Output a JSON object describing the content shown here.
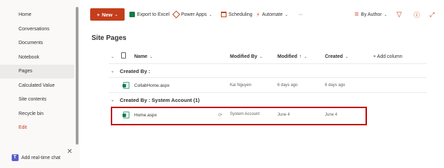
{
  "nav": {
    "items": [
      {
        "label": "Home"
      },
      {
        "label": "Conversations"
      },
      {
        "label": "Documents"
      },
      {
        "label": "Notebook"
      },
      {
        "label": "Pages"
      },
      {
        "label": "Calculated Value"
      },
      {
        "label": "Site contents"
      },
      {
        "label": "Recycle bin"
      },
      {
        "label": "Edit"
      }
    ],
    "selected": "Pages",
    "chat_label": "Add real-time chat",
    "chat_close": "✕"
  },
  "toolbar": {
    "new_label": "New",
    "new_icon": "+",
    "export_label": "Export to Excel",
    "powerapps_label": "Power Apps",
    "scheduling_label": "Scheduling",
    "automate_label": "Automate",
    "more_label": "···",
    "group_by_label": "By Author",
    "chevron": "⌄",
    "filter_icon": "▽",
    "info_icon": "ⓘ",
    "expand_icon": "⤢",
    "sort_icon": "☰"
  },
  "page_title": "Site Pages",
  "list": {
    "columns": {
      "name": "Name",
      "modified_by": "Modified By",
      "modified": "Modified",
      "modified_sort": "↑",
      "created": "Created",
      "add_column": "+ Add column"
    },
    "groups": [
      {
        "label": "Created By :",
        "rows": [
          {
            "name": "CollabHome.aspx",
            "modified_by": "Kai Nguyen",
            "modified": "6 days ago",
            "created": "6 days ago"
          }
        ]
      },
      {
        "label": "Created By : System Account (1)",
        "rows": [
          {
            "name": "Home.aspx",
            "modified_by": "System Account",
            "modified": "June 4",
            "created": "June 4"
          }
        ]
      }
    ],
    "group_chevron": "⌄"
  },
  "colors": {
    "accent": "#c43e1c",
    "highlight_border": "#c00000",
    "nav_background": "#faf9f8",
    "selected_background": "#edebe9"
  }
}
